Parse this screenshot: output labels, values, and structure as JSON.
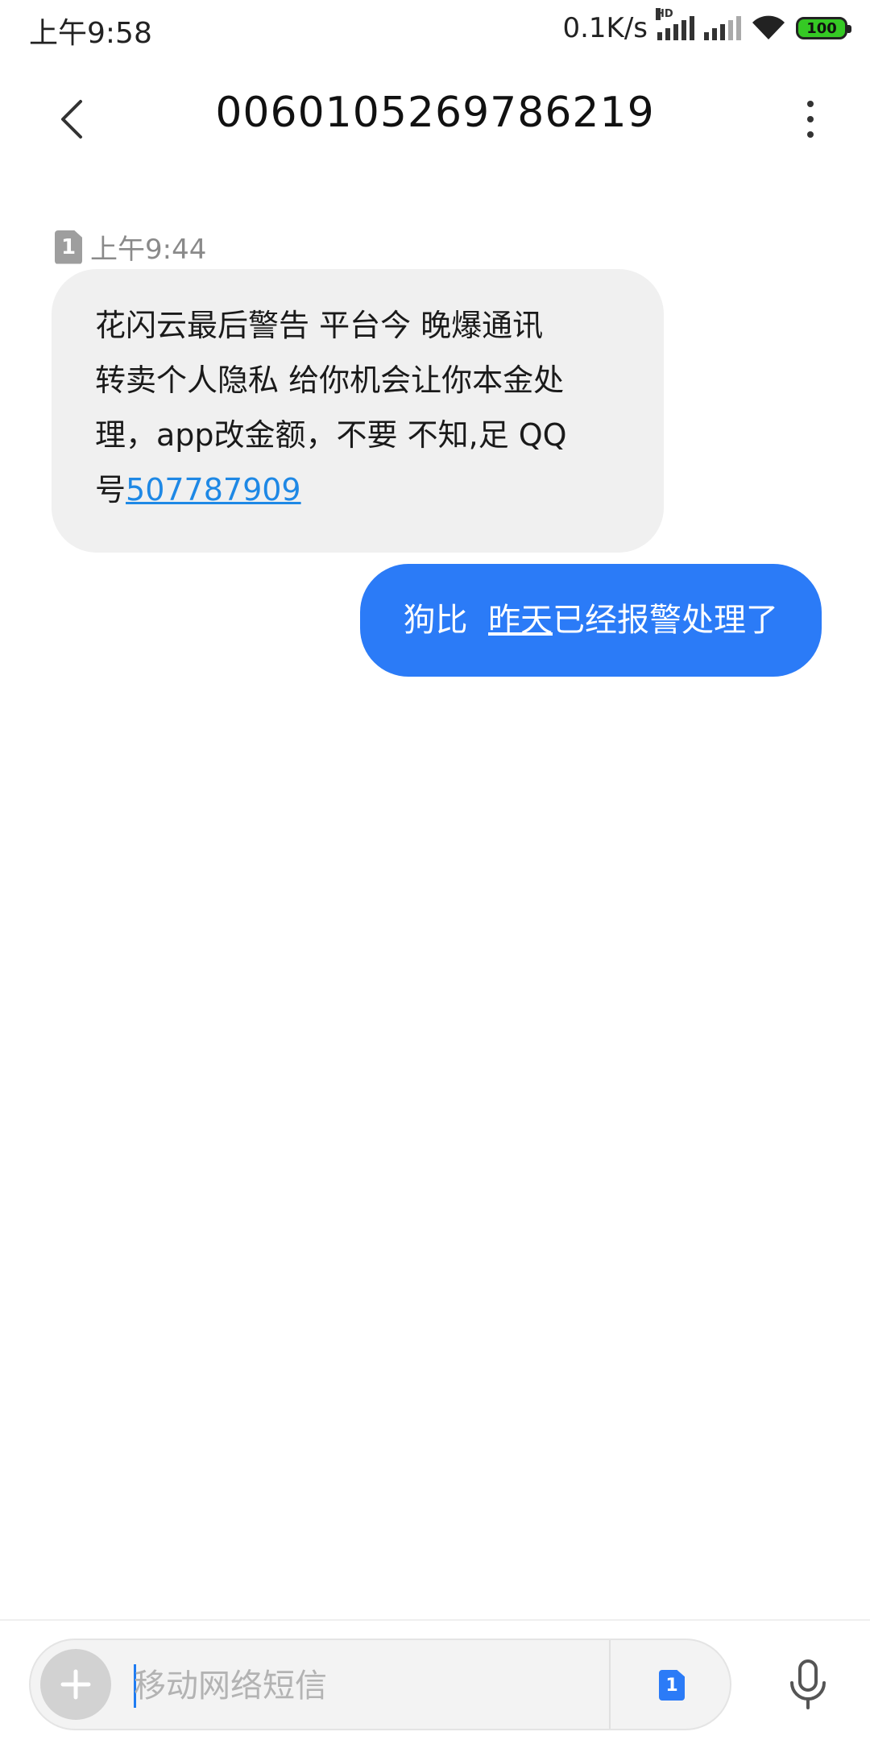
{
  "status_bar": {
    "time": "上午9:58",
    "net_speed": "0.1K/s",
    "hd_label": "HD",
    "battery": "100"
  },
  "header": {
    "title": "0060105269786219"
  },
  "messages": {
    "incoming": {
      "sim_label": "1",
      "time": "上午9:44",
      "text_line1": "花闪云最后警告 平台今 晚爆通讯",
      "text_line2": "转卖个人隐私 给你机会让你本金处",
      "text_line3": "理，app改金额，不要 不知,足 QQ",
      "text_line4_prefix": "号",
      "phone_link": "507787909"
    },
    "outgoing": {
      "text_prefix": "狗比  ",
      "text_underlined": "昨天",
      "text_suffix": "已经报警处理了"
    }
  },
  "compose": {
    "placeholder": "移动网络短信",
    "sim_label": "1"
  },
  "colors": {
    "accent": "#2b7bf7",
    "link": "#1e88e5",
    "incoming_bubble": "#f0f0f0",
    "battery": "#35c924"
  },
  "icons": {
    "back": "chevron-left-icon",
    "more": "more-vertical-icon",
    "add": "plus-icon",
    "mic": "microphone-icon",
    "wifi": "wifi-icon"
  }
}
